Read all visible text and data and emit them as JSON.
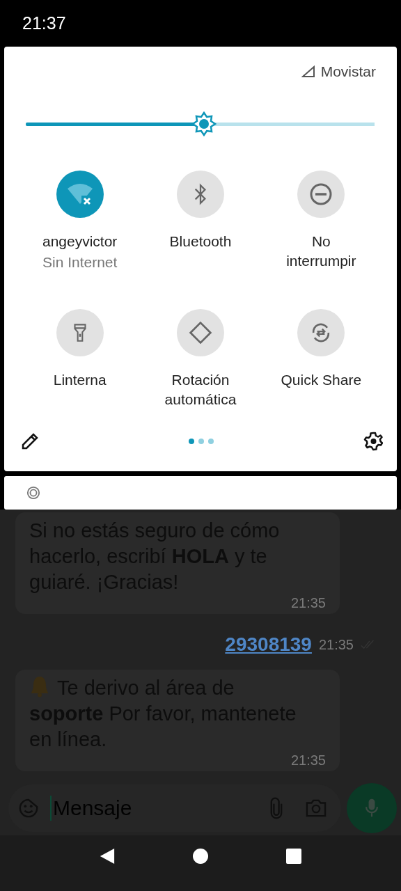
{
  "status_bar": {
    "time": "21:37"
  },
  "quick_settings": {
    "carrier": "Movistar",
    "brightness": {
      "level": 0.51
    },
    "tiles": [
      {
        "label": "angeyvictor",
        "sublabel": "Sin Internet",
        "on": true
      },
      {
        "label": "Bluetooth",
        "on": false
      },
      {
        "label": "No interrumpir",
        "on": false
      },
      {
        "label": "Linterna",
        "on": false
      },
      {
        "label": "Rotación automática",
        "on": false
      },
      {
        "label": "Quick Share",
        "on": false
      }
    ],
    "pages": [
      {
        "selected": true
      },
      {
        "selected": false
      },
      {
        "selected": false
      }
    ]
  },
  "chat": {
    "messages": [
      {
        "kind": "incoming",
        "text": "Si no estás seguro de cómo hacerlo, escribí **HOLA** y te guiaré. ¡Gracias!",
        "time": "21:35"
      },
      {
        "kind": "outgoing",
        "text": "29308139",
        "time": "21:35"
      },
      {
        "kind": "alert",
        "text": "Te derivo al área de **soporte** Por favor, mantenete en línea.",
        "time": "21:35"
      }
    ],
    "composer": {
      "placeholder": "Mensaje"
    }
  }
}
